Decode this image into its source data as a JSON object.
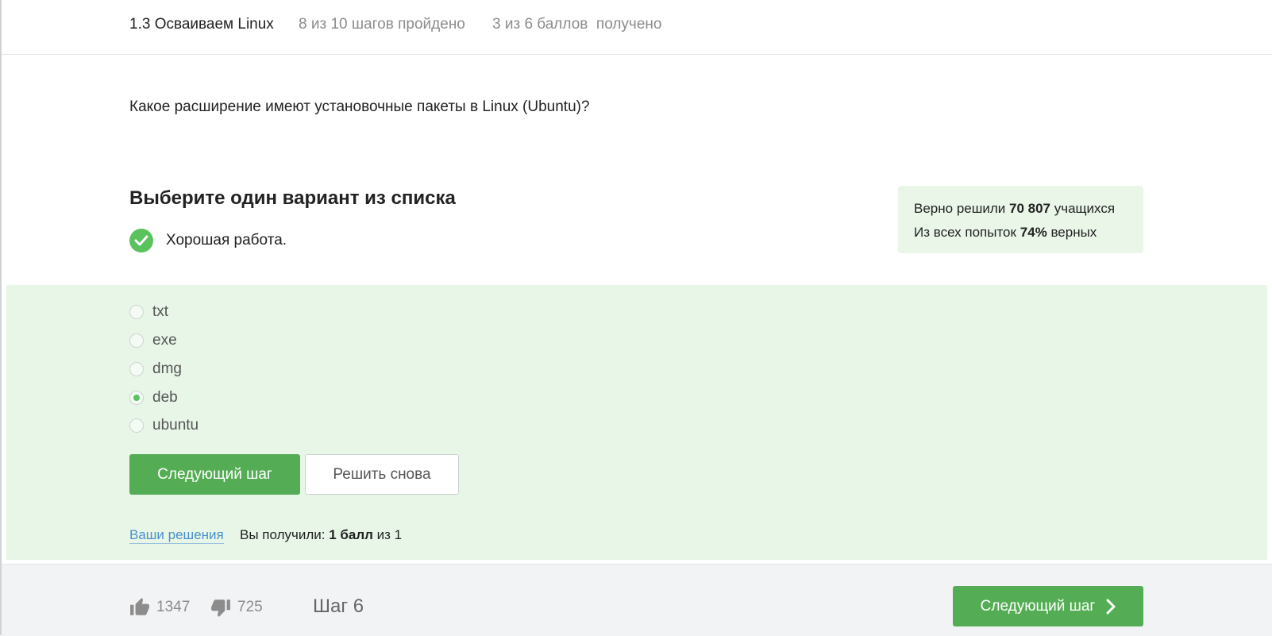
{
  "header": {
    "lesson": "1.3 Осваиваем Linux",
    "steps_progress": "8 из 10 шагов пройдено",
    "points_progress": "3 из 6 баллов  получено"
  },
  "question": "Какое расширение имеют установочные пакеты в Linux (Ubuntu)?",
  "task": {
    "title": "Выберите один вариант из списка",
    "feedback": "Хорошая работа."
  },
  "stats": {
    "solved_prefix": "Верно решили ",
    "solved_count": "70 807",
    "solved_suffix": " учащихся",
    "attempts_prefix": "Из всех попыток ",
    "attempts_percent": "74%",
    "attempts_suffix": " верных"
  },
  "options": [
    "txt",
    "exe",
    "dmg",
    "deb",
    "ubuntu"
  ],
  "selected_option": "deb",
  "buttons": {
    "next_step": "Следующий шаг",
    "solve_again": "Решить снова"
  },
  "result": {
    "solutions_link": "Ваши решения",
    "score_prefix": "Вы получили: ",
    "score_value": "1 балл",
    "score_suffix": " из 1"
  },
  "footer": {
    "likes": "1347",
    "dislikes": "725",
    "step_label": "Шаг 6",
    "next_button": "Следующий шаг"
  },
  "colors": {
    "accent_green": "#54ad54",
    "success_bg": "#e8f6e8",
    "link_blue": "#4a90c9"
  }
}
